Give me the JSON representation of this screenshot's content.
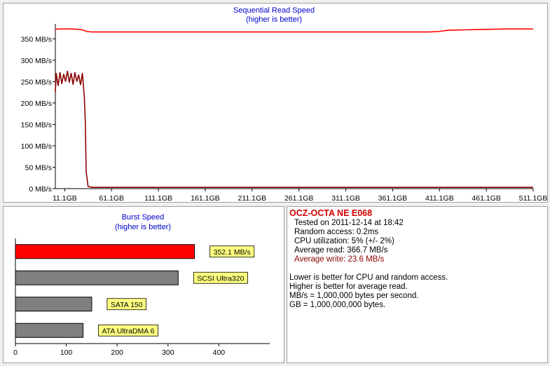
{
  "sequential": {
    "title": "Sequential Read Speed",
    "subtitle": "(higher is better)",
    "y_ticks": [
      "0 MB/s",
      "50 MB/s",
      "100 MB/s",
      "150 MB/s",
      "200 MB/s",
      "250 MB/s",
      "300 MB/s",
      "350 MB/s"
    ],
    "x_ticks": [
      "11.1GB",
      "61.1GB",
      "111.1GB",
      "161.1GB",
      "211.1GB",
      "261.1GB",
      "311.1GB",
      "361.1GB",
      "411.1GB",
      "461.1GB",
      "511.1GB"
    ]
  },
  "burst": {
    "title": "Burst Speed",
    "subtitle": "(higher is better)",
    "x_ticks": [
      "0",
      "100",
      "200",
      "300",
      "400"
    ]
  },
  "info": {
    "title": "OCZ-OCTA NE E068",
    "lines": [
      {
        "text": "Tested on 2011-12-14 at 18:42",
        "color": "#000000"
      },
      {
        "text": "Random access: 0.2ms",
        "color": "#000000"
      },
      {
        "text": "CPU utilization: 5% (+/- 2%)",
        "color": "#000000"
      },
      {
        "text": "Average read: 366.7 MB/s",
        "color": "#000000"
      },
      {
        "text": "Average write: 23.6 MB/s",
        "color": "#8b0000"
      }
    ],
    "notes": [
      "Lower is better for CPU and random access.",
      "Higher is better for average read.",
      "MB/s = 1,000,000 bytes per second.",
      "GB = 1,000,000,000 bytes."
    ]
  },
  "colors": {
    "read_line": "#ff0000",
    "write_line": "#8b0000",
    "bar_highlight": "#ff0000",
    "bar_reference": "#808080",
    "label_bg": "#ffff80"
  },
  "chart_data": [
    {
      "type": "line",
      "title": "Sequential Read Speed",
      "subtitle": "(higher is better)",
      "xlabel": "",
      "ylabel": "",
      "x_unit": "GB",
      "ylim": [
        0,
        385
      ],
      "xlim": [
        1.1,
        511.1
      ],
      "grid": false,
      "series": [
        {
          "color": "#ff0000",
          "x": [
            1.1,
            3,
            10,
            20,
            30,
            35,
            40,
            50,
            100,
            150,
            200,
            250,
            300,
            350,
            400,
            410,
            420,
            440,
            460,
            480,
            500,
            511.1
          ],
          "y": [
            371,
            373,
            373,
            373,
            371,
            367,
            366,
            366,
            366,
            366,
            366,
            366,
            366,
            366,
            366,
            367,
            370,
            371,
            372,
            373,
            373,
            373
          ]
        },
        {
          "color": "#8b0000",
          "x": [
            1.1,
            2,
            4,
            6,
            8,
            10,
            12,
            14,
            16,
            18,
            20,
            22,
            24,
            26,
            28,
            30,
            32,
            33,
            34,
            36,
            40,
            60,
            100,
            200,
            300,
            400,
            511.1
          ],
          "y": [
            225,
            270,
            240,
            272,
            245,
            268,
            250,
            275,
            248,
            270,
            243,
            272,
            250,
            266,
            242,
            270,
            215,
            160,
            40,
            5,
            3,
            3,
            3,
            3,
            3,
            3,
            3
          ]
        }
      ]
    },
    {
      "type": "bar",
      "title": "Burst Speed",
      "subtitle": "(higher is better)",
      "orientation": "horizontal",
      "xlim": [
        0,
        500
      ],
      "categories": [
        "352.1 MB/s",
        "SCSI Ultra320",
        "SATA 150",
        "ATA UltraDMA 6"
      ],
      "values": [
        352.1,
        320,
        150,
        133
      ]
    }
  ]
}
